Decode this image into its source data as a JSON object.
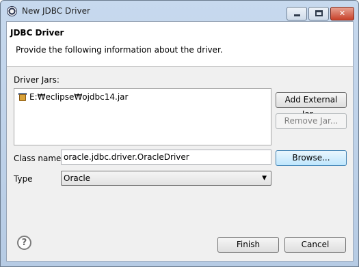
{
  "window": {
    "title": "New JDBC Driver",
    "icon": "eclipse-icon",
    "controls": {
      "minimize": "minimize",
      "maximize": "maximize",
      "close": "✕"
    }
  },
  "header": {
    "title": "JDBC Driver",
    "description": "Provide the following information about the driver."
  },
  "driver_jars": {
    "label": "Driver Jars:",
    "items": [
      {
        "icon": "jar-icon",
        "path": "E:₩eclipse₩ojdbc14.jar"
      }
    ],
    "add_external_button": "Add External Jar...",
    "remove_button": "Remove Jar..."
  },
  "class_name": {
    "label": "Class name:",
    "value": "oracle.jdbc.driver.OracleDriver",
    "browse_button": "Browse..."
  },
  "type": {
    "label": "Type",
    "selected": "Oracle"
  },
  "footer": {
    "help_icon": "?",
    "finish_button": "Finish",
    "cancel_button": "Cancel"
  }
}
